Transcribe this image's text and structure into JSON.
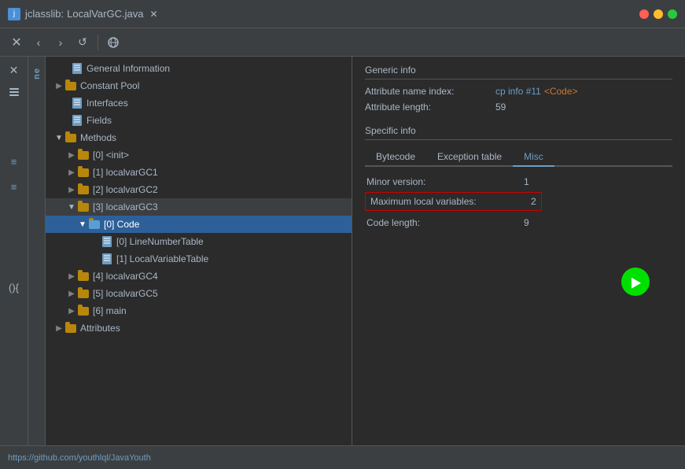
{
  "titleBar": {
    "appName": "jclasslib:",
    "fileName": "LocalVarGC.java",
    "closeLabel": "✕"
  },
  "toolbar": {
    "closeBtn": "✕",
    "backBtn": "‹",
    "forwardBtn": "›",
    "refreshBtn": "↺",
    "globeBtn": "🌐"
  },
  "tree": {
    "items": [
      {
        "id": "general",
        "label": "General Information",
        "indent": 1,
        "hasArrow": false,
        "arrowExpanded": false,
        "iconType": "doc"
      },
      {
        "id": "constant-pool",
        "label": "Constant Pool",
        "indent": 1,
        "hasArrow": true,
        "arrowExpanded": false,
        "iconType": "folder"
      },
      {
        "id": "interfaces",
        "label": "Interfaces",
        "indent": 1,
        "hasArrow": false,
        "arrowExpanded": false,
        "iconType": "doc"
      },
      {
        "id": "fields",
        "label": "Fields",
        "indent": 1,
        "hasArrow": false,
        "arrowExpanded": false,
        "iconType": "doc"
      },
      {
        "id": "methods",
        "label": "Methods",
        "indent": 1,
        "hasArrow": true,
        "arrowExpanded": true,
        "iconType": "folder"
      },
      {
        "id": "init",
        "label": "[0] <init>",
        "indent": 2,
        "hasArrow": true,
        "arrowExpanded": false,
        "iconType": "folder"
      },
      {
        "id": "localvarGC1",
        "label": "[1] localvarGC1",
        "indent": 2,
        "hasArrow": true,
        "arrowExpanded": false,
        "iconType": "folder"
      },
      {
        "id": "localvarGC2",
        "label": "[2] localvarGC2",
        "indent": 2,
        "hasArrow": true,
        "arrowExpanded": false,
        "iconType": "folder"
      },
      {
        "id": "localvarGC3",
        "label": "[3] localvarGC3",
        "indent": 2,
        "hasArrow": true,
        "arrowExpanded": true,
        "iconType": "folder"
      },
      {
        "id": "code",
        "label": "[0] Code",
        "indent": 3,
        "hasArrow": true,
        "arrowExpanded": true,
        "iconType": "folder",
        "selected": true
      },
      {
        "id": "line-number-table",
        "label": "[0] LineNumberTable",
        "indent": 4,
        "hasArrow": false,
        "arrowExpanded": false,
        "iconType": "doc"
      },
      {
        "id": "local-variable-table",
        "label": "[1] LocalVariableTable",
        "indent": 4,
        "hasArrow": false,
        "arrowExpanded": false,
        "iconType": "doc"
      },
      {
        "id": "localvarGC4",
        "label": "[4] localvarGC4",
        "indent": 2,
        "hasArrow": true,
        "arrowExpanded": false,
        "iconType": "folder"
      },
      {
        "id": "localvarGC5",
        "label": "[5] localvarGC5",
        "indent": 2,
        "hasArrow": true,
        "arrowExpanded": false,
        "iconType": "folder"
      },
      {
        "id": "main",
        "label": "[6] main",
        "indent": 2,
        "hasArrow": true,
        "arrowExpanded": false,
        "iconType": "folder"
      },
      {
        "id": "attributes",
        "label": "Attributes",
        "indent": 1,
        "hasArrow": true,
        "arrowExpanded": false,
        "iconType": "folder"
      }
    ]
  },
  "rightPanel": {
    "genericInfoTitle": "Generic info",
    "attributeNameLabel": "Attribute name index:",
    "attributeNameLink": "cp info #11",
    "attributeNameValue": "<Code>",
    "attributeLengthLabel": "Attribute length:",
    "attributeLengthValue": "59",
    "specificInfoTitle": "Specific info",
    "tabs": [
      {
        "id": "bytecode",
        "label": "Bytecode",
        "active": false
      },
      {
        "id": "exception-table",
        "label": "Exception table",
        "active": false
      },
      {
        "id": "misc",
        "label": "Misc",
        "active": true
      }
    ],
    "minorVersionLabel": "Minor version:",
    "minorVersionValue": "1",
    "maxLocalVarsLabel": "Maximum local variables:",
    "maxLocalVarsValue": "2",
    "codeLengthLabel": "Code length:",
    "codeLengthValue": "9"
  },
  "statusBar": {
    "url": "https://github.com/youthlql/JavaYouth"
  },
  "sidebar": {
    "newLabel": "ne"
  }
}
